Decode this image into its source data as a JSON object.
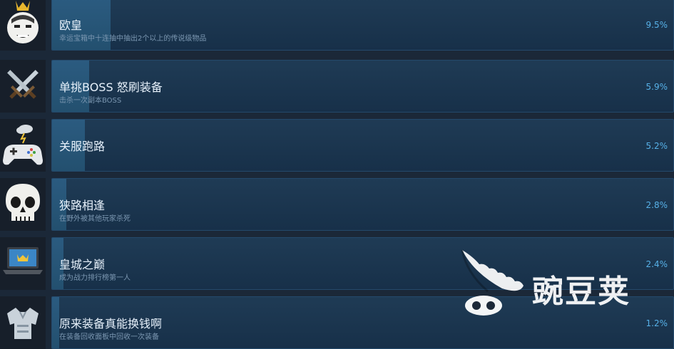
{
  "achievements": [
    {
      "icon": "king-face-icon",
      "title": "欧皇",
      "desc": "幸运宝箱中十连抽中抽出2个以上的传说级物品",
      "percent": "9.5%",
      "progress": 0.095
    },
    {
      "icon": "crossed-swords-icon",
      "title": "单挑BOSS 怒刷装备",
      "desc": "击杀一次副本BOSS",
      "percent": "5.9%",
      "progress": 0.059
    },
    {
      "icon": "gamepad-cloud-icon",
      "title": "关服跑路",
      "desc": "",
      "percent": "5.2%",
      "progress": 0.052
    },
    {
      "icon": "skull-icon",
      "title": "狭路相逢",
      "desc": "在野外被其他玩家杀死",
      "percent": "2.8%",
      "progress": 0.028
    },
    {
      "icon": "laptop-crown-icon",
      "title": "皇城之巅",
      "desc": "成为战力排行榜第一人",
      "percent": "2.4%",
      "progress": 0.024
    },
    {
      "icon": "armor-icon",
      "title": "原来装备真能换钱啊",
      "desc": "在装备回收面板中回收一次装备",
      "percent": "1.2%",
      "progress": 0.012
    }
  ],
  "watermark": {
    "text": "豌豆荚"
  },
  "colors": {
    "background": "#1b2838",
    "panel": "#1f3b55",
    "fill": "#2b5b80",
    "percent": "#57b1e8"
  }
}
